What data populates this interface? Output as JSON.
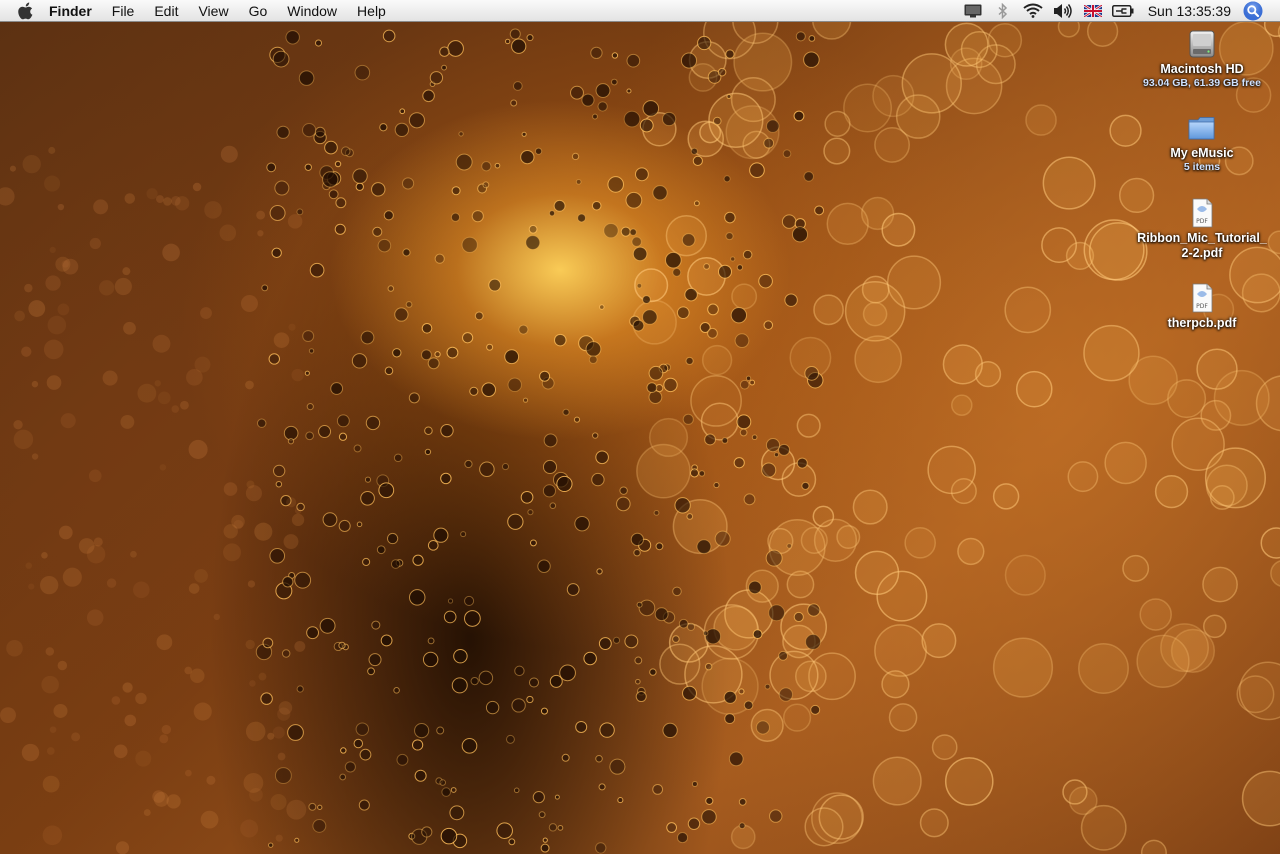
{
  "menubar": {
    "app_name": "Finder",
    "menus": [
      "File",
      "Edit",
      "View",
      "Go",
      "Window",
      "Help"
    ],
    "status_icons": [
      "display-icon",
      "bluetooth-icon",
      "wifi-icon",
      "volume-icon",
      "uk-flag-icon",
      "battery-icon"
    ],
    "clock": "Sun 13:35:39",
    "spotlight_icon": "spotlight-icon"
  },
  "desktop": {
    "icons": [
      {
        "type": "hard-drive-icon",
        "name": "Macintosh HD",
        "info": "93.04 GB, 61.39 GB free"
      },
      {
        "type": "folder-icon",
        "name": "My eMusic",
        "info": "5 items"
      },
      {
        "type": "pdf-icon",
        "name": "Ribbon_Mic_Tutorial_2-2.pdf",
        "name_display": [
          "Ribbon_Mic_Tutorial_",
          "2-2.pdf"
        ],
        "info": ""
      },
      {
        "type": "pdf-icon",
        "name": "therpcb.pdf",
        "info": ""
      }
    ],
    "pdf_badge": "PDF"
  },
  "colors": {
    "menubar_top": "#fafafa",
    "menubar_bottom": "#e3e3e3",
    "folder_blue": "#7fb2ea",
    "spotlight_blue": "#3a6fd8"
  }
}
